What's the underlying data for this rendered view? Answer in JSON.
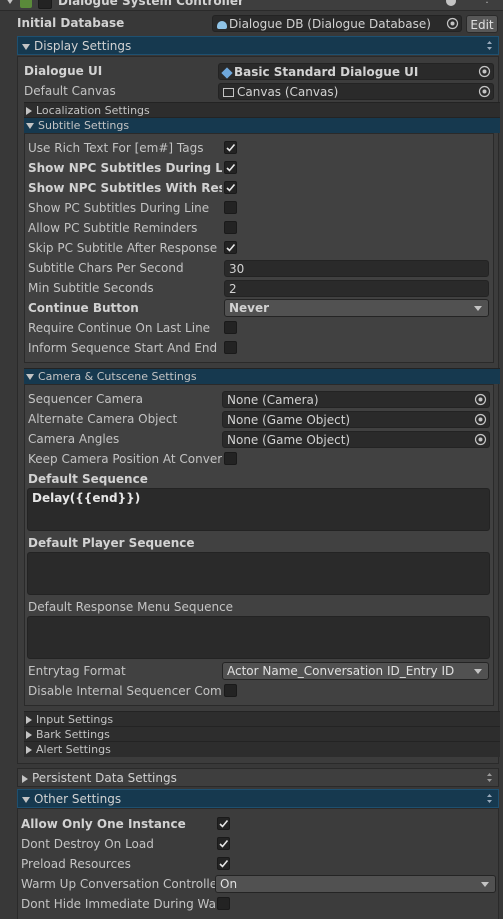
{
  "component": {
    "title": "Dialogue System Controller"
  },
  "initial_database": {
    "label": "Initial Database",
    "value": "Dialogue DB (Dialogue Database)",
    "edit_label": "Edit"
  },
  "display_settings": {
    "title": "Display Settings",
    "dialogue_ui": {
      "label": "Dialogue UI",
      "value": "Basic Standard Dialogue UI"
    },
    "default_canvas": {
      "label": "Default Canvas",
      "value": "Canvas (Canvas)"
    },
    "localization": {
      "title": "Localization Settings"
    },
    "subtitle": {
      "title": "Subtitle Settings",
      "use_rich_text": {
        "label": "Use Rich Text For [em#] Tags",
        "checked": true
      },
      "show_npc_during": {
        "label": "Show NPC Subtitles During Line",
        "checked": true
      },
      "show_npc_with_responses": {
        "label": "Show NPC Subtitles With Respon",
        "checked": true
      },
      "show_pc_during": {
        "label": "Show PC Subtitles During Line",
        "checked": false
      },
      "allow_pc_reminders": {
        "label": "Allow PC Subtitle Reminders",
        "checked": false
      },
      "skip_pc_after_menu": {
        "label": "Skip PC Subtitle After Response M",
        "checked": true
      },
      "chars_per_second": {
        "label": "Subtitle Chars Per Second",
        "value": "30"
      },
      "min_seconds": {
        "label": "Min Subtitle Seconds",
        "value": "2"
      },
      "continue_button": {
        "label": "Continue Button",
        "value": "Never"
      },
      "require_continue_last": {
        "label": "Require Continue On Last Line",
        "checked": false
      },
      "inform_sequence": {
        "label": "Inform Sequence Start And End",
        "checked": false
      }
    },
    "camera": {
      "title": "Camera & Cutscene Settings",
      "sequencer_camera": {
        "label": "Sequencer Camera",
        "value": "None (Camera)"
      },
      "alternate_camera": {
        "label": "Alternate Camera Object",
        "value": "None (Game Object)"
      },
      "camera_angles": {
        "label": "Camera Angles",
        "value": "None (Game Object)"
      },
      "keep_camera_position": {
        "label": "Keep Camera Position At Conversa",
        "checked": false
      },
      "default_sequence": {
        "label": "Default Sequence",
        "value": "Delay({{end}})"
      },
      "default_player_sequence": {
        "label": "Default Player Sequence",
        "value": ""
      },
      "default_response_menu_sequence": {
        "label": "Default Response Menu Sequence",
        "value": ""
      },
      "entrytag_format": {
        "label": "Entrytag Format",
        "value": "Actor Name_Conversation ID_Entry ID"
      },
      "disable_internal_sequencer": {
        "label": "Disable Internal Sequencer Comma",
        "checked": false
      }
    },
    "input": {
      "title": "Input Settings"
    },
    "bark": {
      "title": "Bark Settings"
    },
    "alert": {
      "title": "Alert Settings"
    }
  },
  "persistent_data": {
    "title": "Persistent Data Settings"
  },
  "other_settings": {
    "title": "Other Settings",
    "allow_only_one": {
      "label": "Allow Only One Instance",
      "checked": true
    },
    "dont_destroy": {
      "label": "Dont Destroy On Load",
      "checked": true
    },
    "preload": {
      "label": "Preload Resources",
      "checked": true
    },
    "warm_up": {
      "label": "Warm Up Conversation Controller",
      "value": "On"
    },
    "dont_hide_immediate": {
      "label": "Dont Hide Immediate During Warm",
      "checked": false
    }
  },
  "colors": {
    "background": "#383838",
    "section_open": "#16394f",
    "field": "#2a2a2a",
    "text": "#c4c4c4"
  }
}
